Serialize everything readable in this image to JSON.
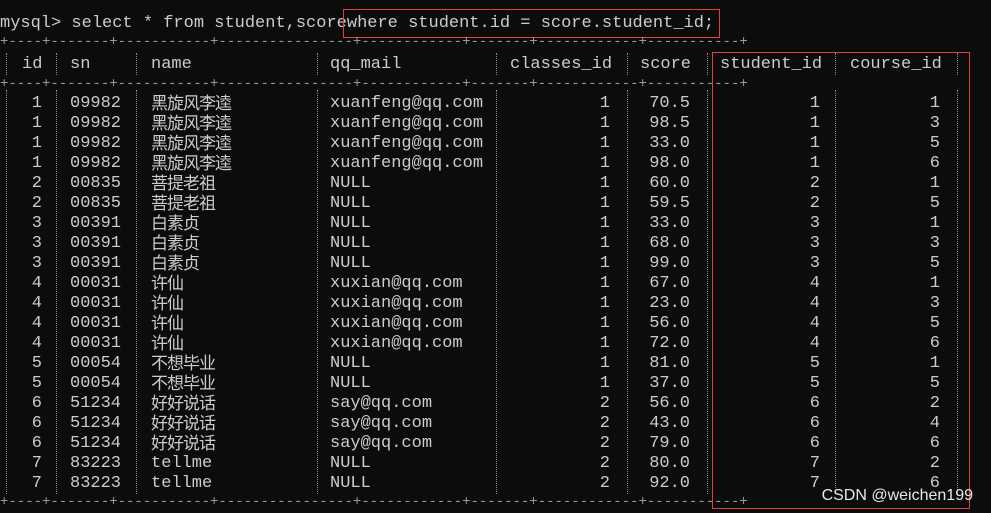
{
  "command": {
    "prompt": "mysql>",
    "query_part1": " select * from student,score",
    "query_where": "where student.id = score.student_id;"
  },
  "borders": {
    "top": "+----+-------+-----------+----------------+------------+-------+------------+-----------+",
    "header_sep": "+----+-------+-----------+----------------+------------+-------+------------+-----------+",
    "bottom": "+----+-------+-----------+----------------+------------+-------+------------+-----------+"
  },
  "columns": [
    "id",
    "sn",
    "name",
    "qq_mail",
    "classes_id",
    "score",
    "student_id",
    "course_id"
  ],
  "rows": [
    [
      "1",
      "09982",
      "黑旋风李逵",
      "xuanfeng@qq.com",
      "1",
      "70.5",
      "1",
      "1"
    ],
    [
      "1",
      "09982",
      "黑旋风李逵",
      "xuanfeng@qq.com",
      "1",
      "98.5",
      "1",
      "3"
    ],
    [
      "1",
      "09982",
      "黑旋风李逵",
      "xuanfeng@qq.com",
      "1",
      "33.0",
      "1",
      "5"
    ],
    [
      "1",
      "09982",
      "黑旋风李逵",
      "xuanfeng@qq.com",
      "1",
      "98.0",
      "1",
      "6"
    ],
    [
      "2",
      "00835",
      "菩提老祖",
      "NULL",
      "1",
      "60.0",
      "2",
      "1"
    ],
    [
      "2",
      "00835",
      "菩提老祖",
      "NULL",
      "1",
      "59.5",
      "2",
      "5"
    ],
    [
      "3",
      "00391",
      "白素贞",
      "NULL",
      "1",
      "33.0",
      "3",
      "1"
    ],
    [
      "3",
      "00391",
      "白素贞",
      "NULL",
      "1",
      "68.0",
      "3",
      "3"
    ],
    [
      "3",
      "00391",
      "白素贞",
      "NULL",
      "1",
      "99.0",
      "3",
      "5"
    ],
    [
      "4",
      "00031",
      "许仙",
      "xuxian@qq.com",
      "1",
      "67.0",
      "4",
      "1"
    ],
    [
      "4",
      "00031",
      "许仙",
      "xuxian@qq.com",
      "1",
      "23.0",
      "4",
      "3"
    ],
    [
      "4",
      "00031",
      "许仙",
      "xuxian@qq.com",
      "1",
      "56.0",
      "4",
      "5"
    ],
    [
      "4",
      "00031",
      "许仙",
      "xuxian@qq.com",
      "1",
      "72.0",
      "4",
      "6"
    ],
    [
      "5",
      "00054",
      "不想毕业",
      "NULL",
      "1",
      "81.0",
      "5",
      "1"
    ],
    [
      "5",
      "00054",
      "不想毕业",
      "NULL",
      "1",
      "37.0",
      "5",
      "5"
    ],
    [
      "6",
      "51234",
      "好好说话",
      "say@qq.com",
      "2",
      "56.0",
      "6",
      "2"
    ],
    [
      "6",
      "51234",
      "好好说话",
      "say@qq.com",
      "2",
      "43.0",
      "6",
      "4"
    ],
    [
      "6",
      "51234",
      "好好说话",
      "say@qq.com",
      "2",
      "79.0",
      "6",
      "6"
    ],
    [
      "7",
      "83223",
      "tellme",
      "NULL",
      "2",
      "80.0",
      "7",
      "2"
    ],
    [
      "7",
      "83223",
      "tellme",
      "NULL",
      "2",
      "92.0",
      "7",
      "6"
    ]
  ],
  "watermark": "CSDN @weichen199",
  "colors": {
    "background": "#0c0c0c",
    "text": "#cccccc",
    "highlight_box": "#e04040"
  }
}
